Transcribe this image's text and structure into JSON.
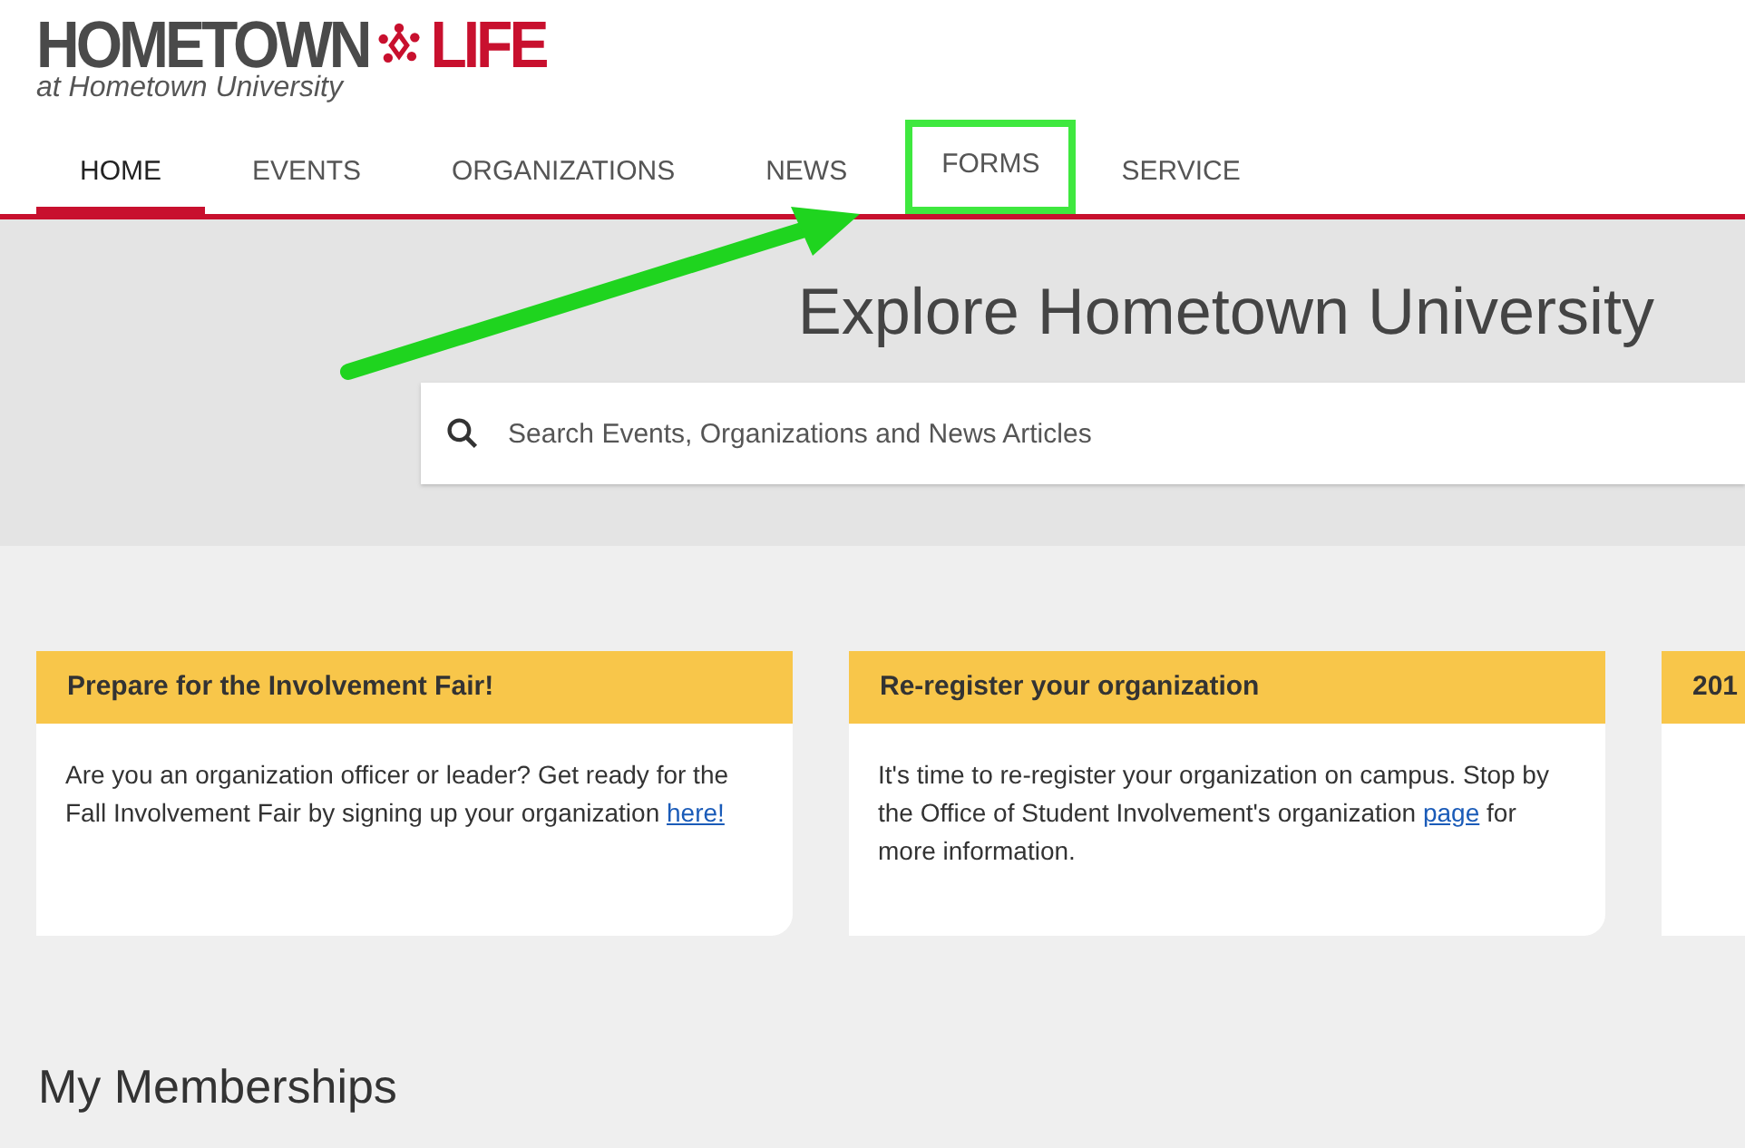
{
  "logo": {
    "word_1": "HOMETOWN",
    "word_2": "LIFE",
    "subtitle": "at Hometown University"
  },
  "nav": [
    {
      "label": "HOME",
      "selected": true,
      "highlighted": false
    },
    {
      "label": "EVENTS",
      "selected": false,
      "highlighted": false
    },
    {
      "label": "ORGANIZATIONS",
      "selected": false,
      "highlighted": false
    },
    {
      "label": "NEWS",
      "selected": false,
      "highlighted": false
    },
    {
      "label": "FORMS",
      "selected": false,
      "highlighted": true
    },
    {
      "label": "SERVICE",
      "selected": false,
      "highlighted": false
    }
  ],
  "hero": {
    "title": "Explore Hometown University",
    "search": {
      "placeholder": "Search Events, Organizations and News Articles"
    }
  },
  "cards": [
    {
      "title": "Prepare for the Involvement Fair!",
      "text_before": "Are you an organization officer or leader? Get ready for the Fall Involvement Fair by signing up your organization ",
      "link": "here!"
    },
    {
      "title": "Re-register your organization",
      "text_before": "It's time to re-register your organization on campus. Stop by the Office of Student Involvement's organization ",
      "link": "page",
      "text_after": " for more information."
    },
    {
      "title": "201"
    }
  ],
  "section_title": "My Memberships"
}
